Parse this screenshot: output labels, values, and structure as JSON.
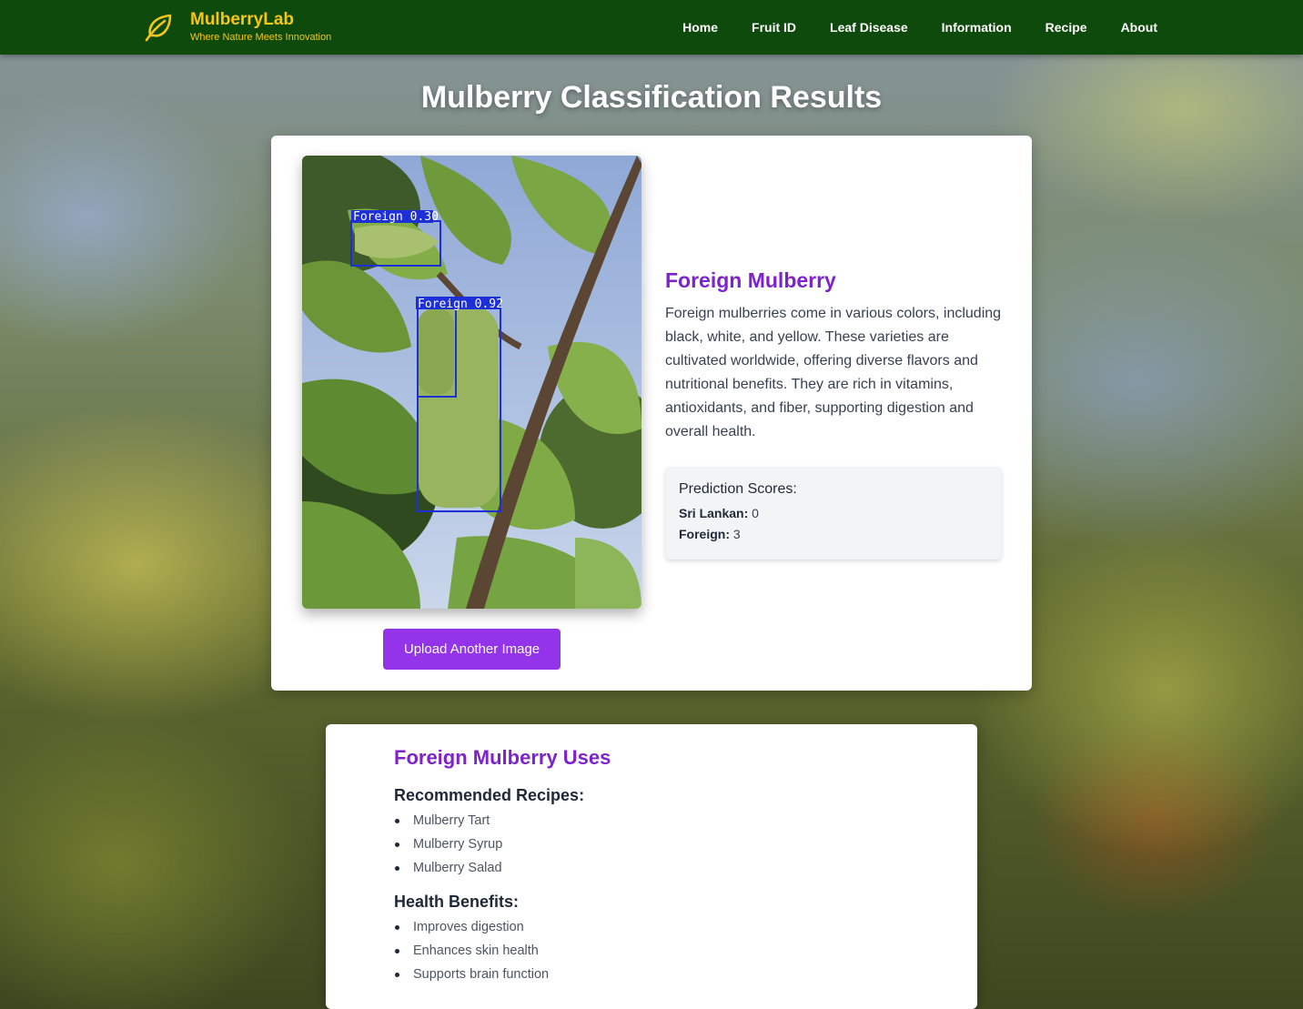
{
  "brand": {
    "name": "MulberryLab",
    "tagline": "Where Nature Meets Innovation",
    "icon": "leaf-icon"
  },
  "nav": {
    "links": [
      "Home",
      "Fruit ID",
      "Leaf Disease",
      "Information",
      "Recipe",
      "About"
    ]
  },
  "page": {
    "title": "Mulberry Classification Results"
  },
  "result": {
    "detections": [
      {
        "label": "Foreign 0.30"
      },
      {
        "label": "Foreign 0.92"
      }
    ],
    "upload_button": "Upload Another Image",
    "variety_title": "Foreign Mulberry",
    "description": "Foreign mulberries come in various colors, including black, white, and yellow. These varieties are cultivated worldwide, offering diverse flavors and nutritional benefits. They are rich in vitamins, antioxidants, and fiber, supporting digestion and overall health.",
    "scores": {
      "title": "Prediction Scores:",
      "sri_lankan_label": "Sri Lankan:",
      "sri_lankan_value": "0",
      "foreign_label": "Foreign:",
      "foreign_value": "3"
    }
  },
  "uses": {
    "title": "Foreign Mulberry Uses",
    "recipes_heading": "Recommended Recipes:",
    "recipes": [
      "Mulberry Tart",
      "Mulberry Syrup",
      "Mulberry Salad"
    ],
    "benefits_heading": "Health Benefits:",
    "benefits": [
      "Improves digestion",
      "Enhances skin health",
      "Supports brain function"
    ]
  },
  "colors": {
    "nav_bg": "#0e4a0b",
    "brand": "#f5c518",
    "accent": "#7e22ce",
    "button": "#9333ea",
    "detection_box": "#1d2fd6"
  }
}
